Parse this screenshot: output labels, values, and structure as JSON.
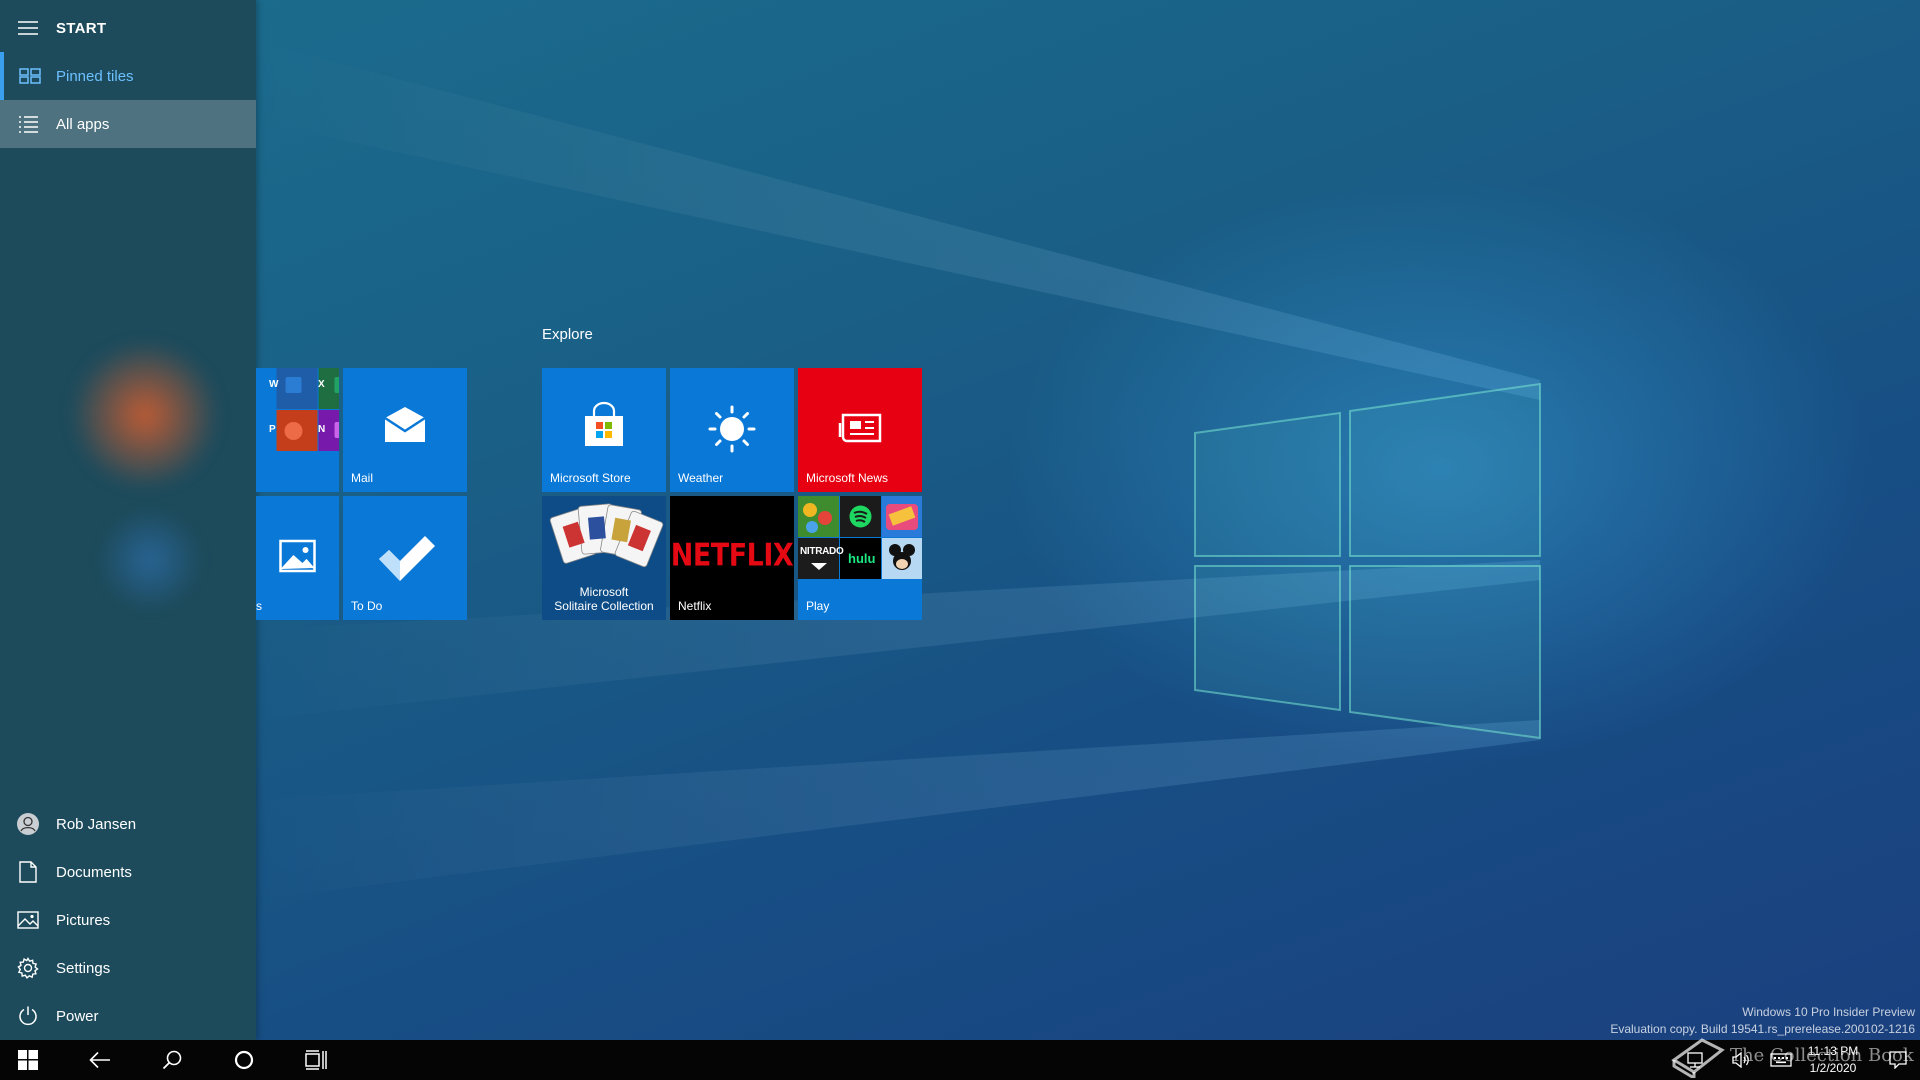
{
  "start_menu": {
    "title": "START",
    "nav": [
      {
        "label": "Pinned tiles"
      },
      {
        "label": "All apps"
      }
    ],
    "bottom": [
      {
        "label": "Rob Jansen"
      },
      {
        "label": "Documents"
      },
      {
        "label": "Pictures"
      },
      {
        "label": "Settings"
      },
      {
        "label": "Power"
      }
    ]
  },
  "tiles": {
    "group_title": "Explore",
    "left_group": [
      {
        "label": ""
      },
      {
        "label": "Mail"
      },
      {
        "label": "s"
      },
      {
        "label": "To Do"
      }
    ],
    "explore": [
      {
        "label": "Microsoft Store"
      },
      {
        "label": "Weather"
      },
      {
        "label": "Microsoft News"
      },
      {
        "label": "Microsoft\nSolitaire Collection",
        "line1": "Microsoft",
        "line2": "Solitaire Collection"
      },
      {
        "label": "Netflix",
        "logo": "NETFLIX"
      },
      {
        "label": "Play",
        "nitrado": "NITRADO",
        "hulu": "hulu"
      }
    ],
    "office_letters": [
      "W",
      "X",
      "P",
      "N"
    ]
  },
  "taskbar": {
    "clock_time": "11:13 PM",
    "clock_date": "1/2/2020"
  },
  "watermark": {
    "line1": "Windows 10 Pro Insider Preview",
    "line2": "Evaluation copy. Build 19541.rs_prerelease.200102-1216"
  },
  "overlay": "The Collection Book",
  "colors": {
    "tile_blue": "#0a78d7",
    "news_red": "#e60012",
    "netflix_red": "#e50914",
    "accent": "#3aa0ee"
  }
}
